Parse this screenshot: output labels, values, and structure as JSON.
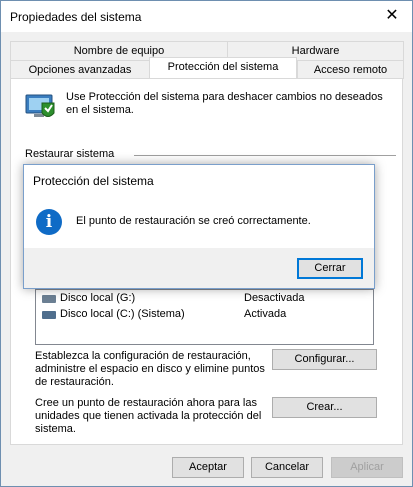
{
  "window": {
    "title": "Propiedades del sistema",
    "close_glyph": "✕"
  },
  "tabs": {
    "row1": [
      "Nombre de equipo",
      "Hardware"
    ],
    "row2": [
      "Opciones avanzadas",
      "Protección del sistema",
      "Acceso remoto"
    ],
    "active": "Protección del sistema"
  },
  "intro": "Use Protección del sistema para deshacer cambios no deseados en el sistema.",
  "restore": {
    "heading": "Restaurar sistema"
  },
  "protection": {
    "drives": [
      {
        "name": "Disco local (G:)",
        "status": "Desactivada",
        "icon": "drive-icon"
      },
      {
        "name": "Disco local (C:) (Sistema)",
        "status": "Activada",
        "icon": "system-drive-icon"
      }
    ]
  },
  "configure": {
    "text": "Establezca la configuración de restauración, administre el espacio en disco y elimine puntos de restauración.",
    "button": "Configurar..."
  },
  "create": {
    "text": "Cree un punto de restauración ahora para las unidades que tienen activada la protección del sistema.",
    "button": "Crear..."
  },
  "footer": {
    "ok": "Aceptar",
    "cancel": "Cancelar",
    "apply": "Aplicar"
  },
  "dialog": {
    "title": "Protección del sistema",
    "message": "El punto de restauración se creó correctamente.",
    "button": "Cerrar",
    "icon": "info-icon",
    "icon_glyph": "i"
  },
  "colors": {
    "accent": "#0078d7",
    "info_blue": "#0f6bc6"
  }
}
